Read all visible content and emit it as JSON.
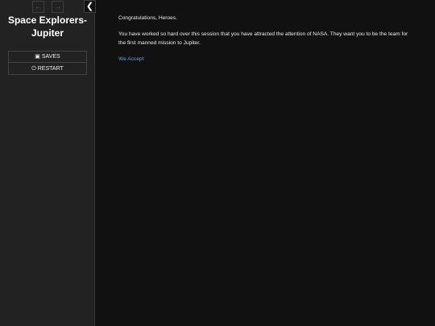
{
  "sidebar": {
    "history_back_icon": "arrow-left-icon",
    "history_forward_icon": "arrow-right-icon",
    "toggle_icon": "chevron-left-icon",
    "story_title": "Space Explorers-Jupiter",
    "saves_label": "SAVES",
    "saves_icon": "save-icon",
    "restart_label": "RESTART",
    "restart_icon": "power-icon"
  },
  "passage": {
    "greeting": "Congratulations, Heroes.",
    "body": "You have worked so hard over this session that you have attracted the attention of NASA. They want you to be the team for the first manned mission to Jupiter.",
    "link_label": "We Accept"
  },
  "colors": {
    "background": "#111111",
    "sidebar": "#222222",
    "link": "#68a4dd"
  }
}
